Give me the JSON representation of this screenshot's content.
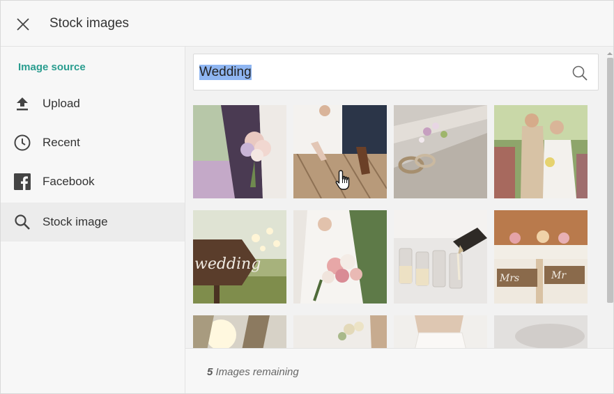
{
  "header": {
    "title": "Stock images",
    "close_icon": "close-icon"
  },
  "sidebar": {
    "heading": "Image source",
    "items": [
      {
        "label": "Upload",
        "icon": "upload-icon",
        "active": false
      },
      {
        "label": "Recent",
        "icon": "clock-icon",
        "active": false
      },
      {
        "label": "Facebook",
        "icon": "facebook-icon",
        "active": false
      },
      {
        "label": "Stock image",
        "icon": "search-icon",
        "active": true
      }
    ]
  },
  "search": {
    "value": "Wedding",
    "icon": "search-icon"
  },
  "images": [
    {
      "subject": "couple-bouquet"
    },
    {
      "subject": "couple-shoes-boardwalk"
    },
    {
      "subject": "rings-flowers-wood"
    },
    {
      "subject": "couple-walking-aisle"
    },
    {
      "subject": "wedding-wood-sign"
    },
    {
      "subject": "bride-bouquet"
    },
    {
      "subject": "champagne-pouring"
    },
    {
      "subject": "mr-mrs-chairs"
    },
    {
      "subject": "sunset-couple"
    },
    {
      "subject": "bride-flower-crown"
    },
    {
      "subject": "bride-dress"
    },
    {
      "subject": "blurred-detail"
    }
  ],
  "footer": {
    "count": "5",
    "text": " Images remaining"
  },
  "colors": {
    "accent": "#2a9d8f",
    "selection": "#8fb6f2",
    "panel": "#f7f7f7",
    "active_item": "#ececec"
  }
}
